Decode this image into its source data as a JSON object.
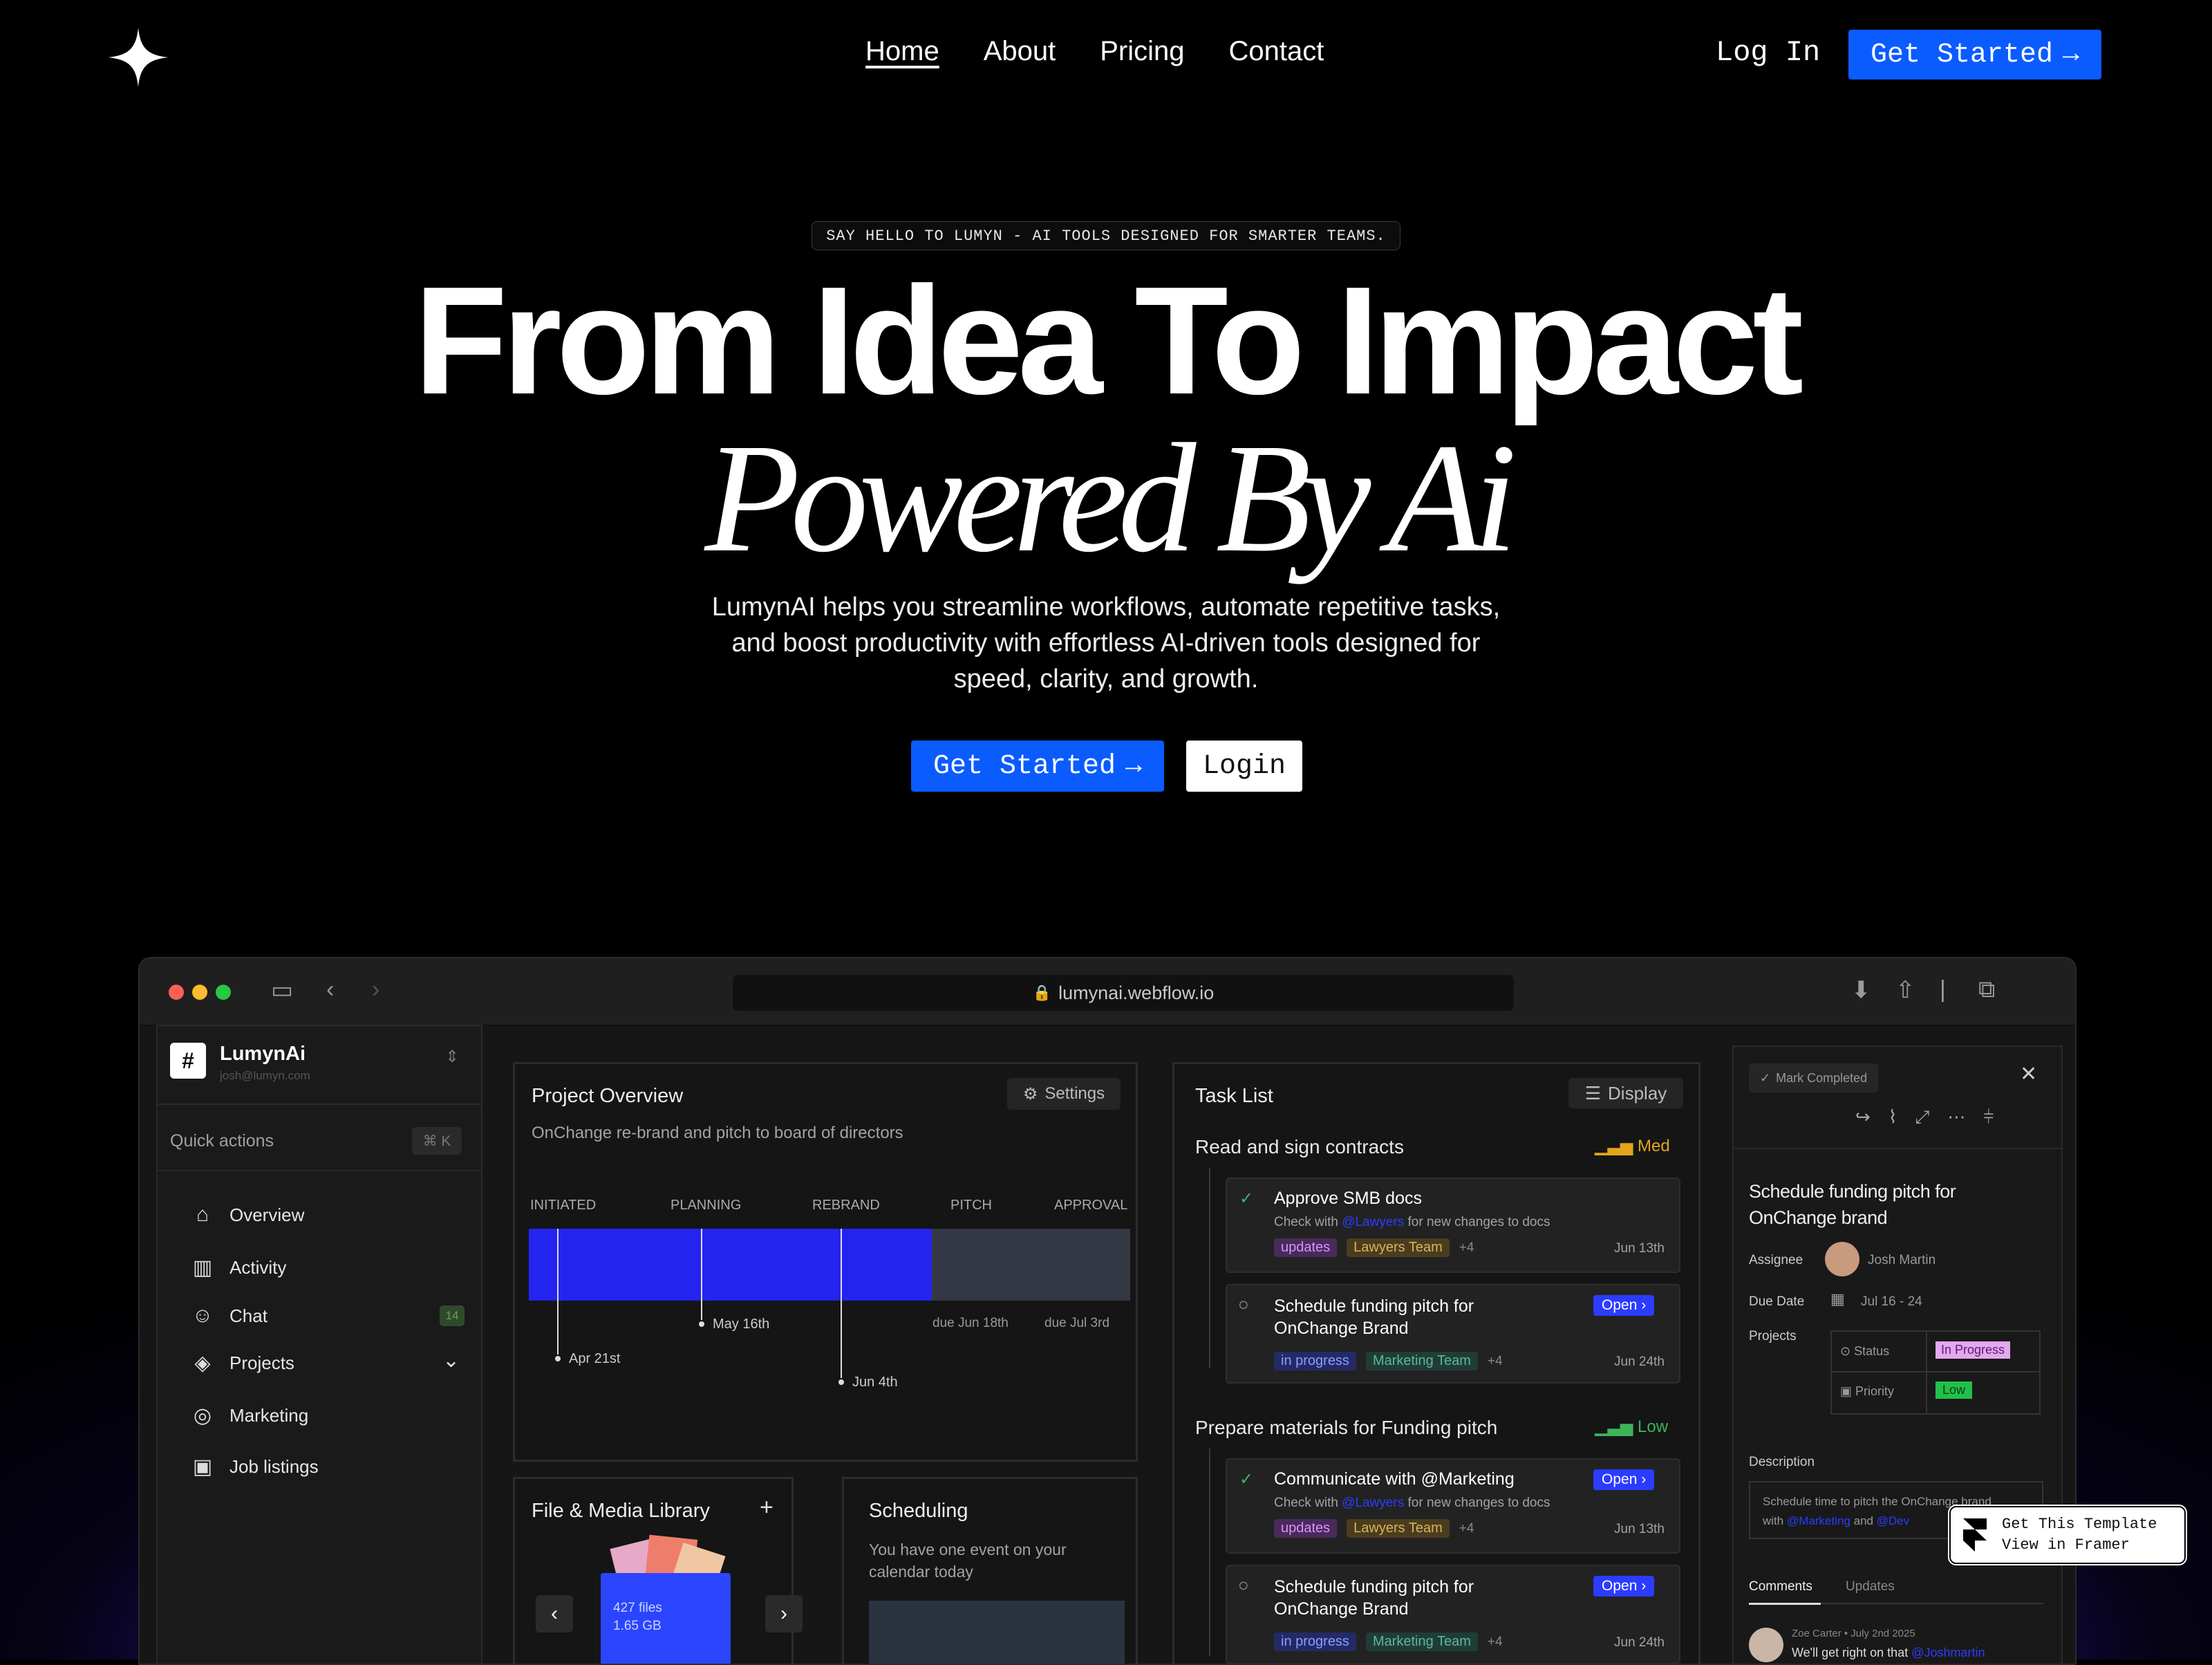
{
  "nav": {
    "links": [
      "Home",
      "About",
      "Pricing",
      "Contact"
    ],
    "login": "Log In",
    "cta": "Get Started",
    "arrow": "→"
  },
  "hero": {
    "tagline": "SAY HELLO TO LUMYN - AI TOOLS DESIGNED FOR SMARTER TEAMS.",
    "title_line1": "From Idea To Impact",
    "title_line2": "Powered By Ai",
    "description_lines": [
      "LumynAI helps you streamline workflows, automate repetitive tasks,",
      "and boost productivity with effortless AI-driven tools designed for",
      "speed, clarity, and growth."
    ],
    "cta": "Get Started",
    "login": "Login"
  },
  "browser": {
    "url": "lumynai.webflow.io"
  },
  "sidebar": {
    "workspace_initial": "#",
    "workspace_name": "LumynAi",
    "workspace_email": "josh@lumyn.com",
    "quick_actions": "Quick actions",
    "shortcut": "⌘ K",
    "items": [
      {
        "label": "Overview",
        "icon": "home-icon"
      },
      {
        "label": "Activity",
        "icon": "activity-icon"
      },
      {
        "label": "Chat",
        "icon": "users-icon",
        "badge": "14"
      },
      {
        "label": "Projects",
        "icon": "layers-icon"
      },
      {
        "label": "Marketing",
        "icon": "megaphone-icon"
      },
      {
        "label": "Job listings",
        "icon": "briefcase-icon"
      }
    ]
  },
  "project_overview": {
    "title": "Project Overview",
    "settings": "Settings",
    "subtitle": "OnChange re-brand and pitch to board of directors",
    "phases": [
      "INITIATED",
      "PLANNING",
      "REBRAND",
      "PITCH",
      "APPROVAL"
    ],
    "progress_fraction": 0.67,
    "milestones": [
      "Apr 21st",
      "May 16th",
      "Jun 4th"
    ],
    "dues": [
      "due Jun 18th",
      "due Jul 3rd"
    ]
  },
  "file_library": {
    "title": "File & Media Library",
    "files": "427 files",
    "size": "1.65 GB"
  },
  "scheduling": {
    "title": "Scheduling",
    "text_lines": [
      "You have one event on your",
      "calendar today"
    ]
  },
  "task_list": {
    "title": "Task List",
    "display": "Display",
    "groups": [
      {
        "title": "Read and sign contracts",
        "priority": "Med",
        "tasks": [
          {
            "title": "Approve SMB docs",
            "sub_a": "Check with",
            "mention": "@Lawyers",
            "sub_b": "for new changes to docs",
            "tag1": "updates",
            "tag2": "Lawyers Team",
            "more": "+4",
            "date": "Jun 13th",
            "done": true
          },
          {
            "title_lines": [
              "Schedule funding pitch for",
              "OnChange Brand"
            ],
            "tag1": "in progress",
            "tag2": "Marketing Team",
            "more": "+4",
            "date": "Jun 24th",
            "status": "Open"
          }
        ]
      },
      {
        "title": "Prepare materials for Funding pitch",
        "priority": "Low",
        "tasks": [
          {
            "title": "Communicate with @Marketing",
            "sub_a": "Check with",
            "mention": "@Lawyers",
            "sub_b": "for new changes to docs",
            "tag1": "updates",
            "tag2": "Lawyers Team",
            "more": "+4",
            "date": "Jun 13th",
            "status": "Open",
            "done": true
          },
          {
            "title_lines": [
              "Schedule funding pitch for",
              "OnChange Brand"
            ],
            "tag1": "in progress",
            "tag2": "Marketing Team",
            "more": "+4",
            "date": "Jun 24th",
            "status": "Open"
          }
        ]
      }
    ]
  },
  "detail": {
    "mark_completed": "Mark Completed",
    "title_lines": [
      "Schedule funding pitch for",
      "OnChange brand"
    ],
    "assignee_label": "Assignee",
    "assignee": "Josh Martin",
    "due_label": "Due Date",
    "due": "Jul 16 - 24",
    "projects_label": "Projects",
    "status_label": "Status",
    "status": "In Progress",
    "priority_label": "Priority",
    "priority": "Low",
    "description_label": "Description",
    "description_a": "Schedule time to pitch the OnChange brand",
    "description_b1": "with",
    "description_m1": "@Marketing",
    "description_b2": "and",
    "description_m2": "@Dev",
    "tabs": [
      "Comments",
      "Updates"
    ],
    "comment_meta": "Zoe Carter • July 2nd 2025",
    "comment_a": "We'll get right on that",
    "comment_m": "@Joshmartin"
  },
  "framer_badge": {
    "line1": "Get This Template",
    "line2": "View in Framer"
  },
  "colors": {
    "accent": "#0a5cff",
    "bar": "#2424f0",
    "bg": "#000000"
  }
}
